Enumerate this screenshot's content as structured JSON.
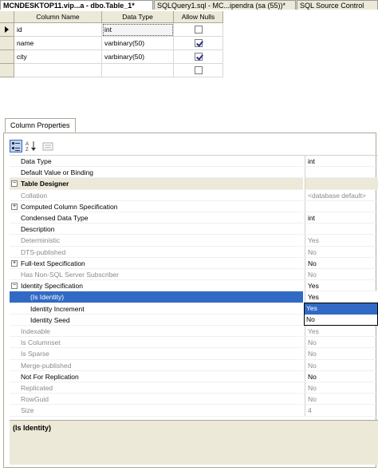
{
  "tabs": [
    {
      "label": "MCNDESKTOP11.vip...a - dbo.Table_1*",
      "active": true
    },
    {
      "label": "SQLQuery1.sql - MC...ipendra (sa (55))*",
      "active": false
    },
    {
      "label": "SQL Source Control",
      "active": false
    }
  ],
  "designer": {
    "headers": {
      "name": "Column Name",
      "type": "Data Type",
      "nulls": "Allow Nulls"
    },
    "rows": [
      {
        "name": "id",
        "type": "int",
        "allow_nulls": false
      },
      {
        "name": "name",
        "type": "varbinary(50)",
        "allow_nulls": true
      },
      {
        "name": "city",
        "type": "varbinary(50)",
        "allow_nulls": true
      },
      {
        "name": "",
        "type": "",
        "allow_nulls": false
      }
    ]
  },
  "properties": {
    "tab_label": "Column Properties",
    "toolbar": {
      "categorized": "categorized-icon",
      "alphabetical": "sort-az-icon",
      "pages": "property-pages-icon"
    },
    "rows": [
      {
        "name": "Data Type",
        "value": "int",
        "kind": "prop"
      },
      {
        "name": "Default Value or Binding",
        "value": "",
        "kind": "prop"
      },
      {
        "name": "Table Designer",
        "value": "",
        "kind": "cat",
        "expander": "−"
      },
      {
        "name": "Collation",
        "value": "<database default>",
        "kind": "dim"
      },
      {
        "name": "Computed Column Specification",
        "value": "",
        "kind": "prop",
        "expander": "+"
      },
      {
        "name": "Condensed Data Type",
        "value": "int",
        "kind": "prop"
      },
      {
        "name": "Description",
        "value": "",
        "kind": "prop"
      },
      {
        "name": "Deterministic",
        "value": "Yes",
        "kind": "dim"
      },
      {
        "name": "DTS-published",
        "value": "No",
        "kind": "dim"
      },
      {
        "name": "Full-text Specification",
        "value": "No",
        "kind": "prop",
        "expander": "+"
      },
      {
        "name": "Has Non-SQL Server Subscriber",
        "value": "No",
        "kind": "dim"
      },
      {
        "name": "Identity Specification",
        "value": "Yes",
        "kind": "prop",
        "expander": "−"
      },
      {
        "name": "(Is Identity)",
        "value": "Yes",
        "kind": "sel"
      },
      {
        "name": "Identity Increment",
        "value": "",
        "kind": "child"
      },
      {
        "name": "Identity Seed",
        "value": "",
        "kind": "child"
      },
      {
        "name": "Indexable",
        "value": "Yes",
        "kind": "dim"
      },
      {
        "name": "Is Columnset",
        "value": "No",
        "kind": "dim"
      },
      {
        "name": "Is Sparse",
        "value": "No",
        "kind": "dim"
      },
      {
        "name": "Merge-published",
        "value": "No",
        "kind": "dim"
      },
      {
        "name": "Not For Replication",
        "value": "No",
        "kind": "prop"
      },
      {
        "name": "Replicated",
        "value": "No",
        "kind": "dim"
      },
      {
        "name": "RowGuid",
        "value": "No",
        "kind": "dim"
      },
      {
        "name": "Size",
        "value": "4",
        "kind": "dim"
      }
    ],
    "dropdown": {
      "options": [
        "Yes",
        "No"
      ],
      "highlighted": "Yes"
    },
    "description": "(Is Identity)"
  }
}
